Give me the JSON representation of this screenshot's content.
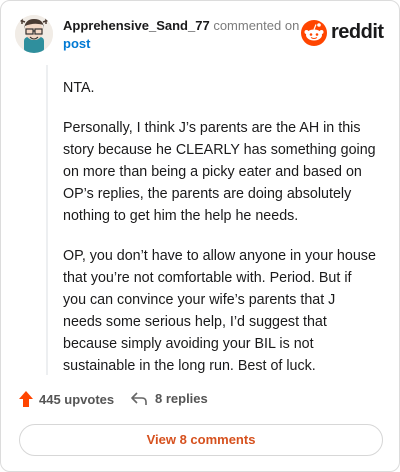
{
  "header": {
    "username": "Apprehensive_Sand_77",
    "action_text": "commented on",
    "post_link": "post",
    "logo_text": "reddit"
  },
  "comment": {
    "paragraphs": [
      "NTA.",
      "Personally, I think J’s parents are the AH in this story because he CLEARLY has something going on more than being a picky eater and based on OP’s replies, the parents are doing absolutely nothing to get him the help he needs.",
      "OP, you don’t have to allow anyone in your house that you’re not comfortable with. Period. But if you can convince your wife’s parents that J needs some serious help, I’d suggest that because simply avoiding your BIL is not sustainable in the long run. Best of luck."
    ]
  },
  "actions": {
    "upvotes": "445 upvotes",
    "replies": "8 replies"
  },
  "footer": {
    "view_comments": "View 8 comments"
  },
  "colors": {
    "upvote_accent": "#ff4500",
    "link_blue": "#0079d3",
    "view_button_text": "#d6511e",
    "reddit_orange": "#ff4500"
  },
  "icons": {
    "upvote": "arrow-up-icon",
    "reply": "reply-arrow-icon",
    "logo": "reddit-snoo-icon"
  }
}
